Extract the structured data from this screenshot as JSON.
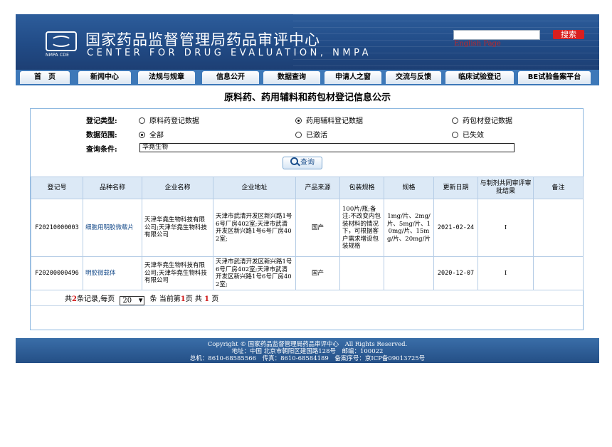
{
  "header": {
    "logo_caption": "NMPA CDE",
    "title": "国家药品监督管理局药品审评中心",
    "subtitle": "CENTER FOR DRUG EVALUATION, NMPA",
    "search_button": "搜索",
    "english_link": "English Page"
  },
  "nav": {
    "tabs": [
      "首　页",
      "新闻中心",
      "法规与规章",
      "信息公开",
      "数据查询",
      "申请人之窗",
      "交流与反馈",
      "临床试验登记",
      "BE试验备案平台"
    ]
  },
  "page_title": "原料药、药用辅料和药包材登记信息公示",
  "form": {
    "type_label": "登记类型:",
    "type_options": [
      "原料药登记数据",
      "药用辅料登记数据",
      "药包材登记数据"
    ],
    "type_selected": "药用辅料登记数据",
    "range_label": "数据范围:",
    "range_options": [
      "全部",
      "已激活",
      "已失效"
    ],
    "range_selected": "全部",
    "query_label": "查询条件:",
    "query_value": "华堯生物",
    "query_button": "查询"
  },
  "table": {
    "headers": [
      "登记号",
      "品种名称",
      "企业名称",
      "企业地址",
      "产品来源",
      "包装规格",
      "规格",
      "更新日期",
      "与制剂共同审评审批结果",
      "备注"
    ],
    "rows": [
      {
        "reg_no": "F20210000003",
        "name": "细胞用明胶微载片",
        "company": "天津华堯生物科技有限公司;天津华堯生物科技有限公司",
        "address": "天津市武清开发区新兴路1号6号厂房402室;天津市武清开发区新兴路1号6号厂房402室;",
        "source": "国产",
        "package": "100片/瓶;备注:不改变内包装材料的情况下，可根据客户需求增设包装规格",
        "spec": "1mg/片、2mg/片、5mg/片、10mg/片、15mg/片、20mg/片",
        "date": "2021-02-24",
        "result": "I",
        "note": ""
      },
      {
        "reg_no": "F20200000496",
        "name": "明胶微载体",
        "company": "天津华堯生物科技有限公司;天津华堯生物科技有限公司",
        "address": "天津市武清开发区新兴路1号6号厂房402室;天津市武清开发区新兴路1号6号厂房402室;",
        "source": "国产",
        "package": "",
        "spec": "",
        "date": "2020-12-07",
        "result": "I",
        "note": ""
      }
    ]
  },
  "pager": {
    "prefix": "共",
    "total": "2",
    "mid1": "条记录,每页",
    "page_size": "20",
    "mid2": "条 当前第",
    "current": "1",
    "mid3": "页 共",
    "pages": "1",
    "suffix": "页"
  },
  "footer": {
    "line1": "Copyright © 国家药品监督管理局药品审评中心　All Rights Reserved.",
    "line2": "地址：中国 北京市朝阳区建国路128号　邮编：100022",
    "line3": "总机：8610-68585566　传真：8610-68584189　备案序号：京ICP备09013725号"
  },
  "colors": {
    "header_blue": "#214b86",
    "nav_blue": "#3d78b8",
    "search_red": "#d81f1f",
    "table_header_bg": "#dce9f6"
  }
}
